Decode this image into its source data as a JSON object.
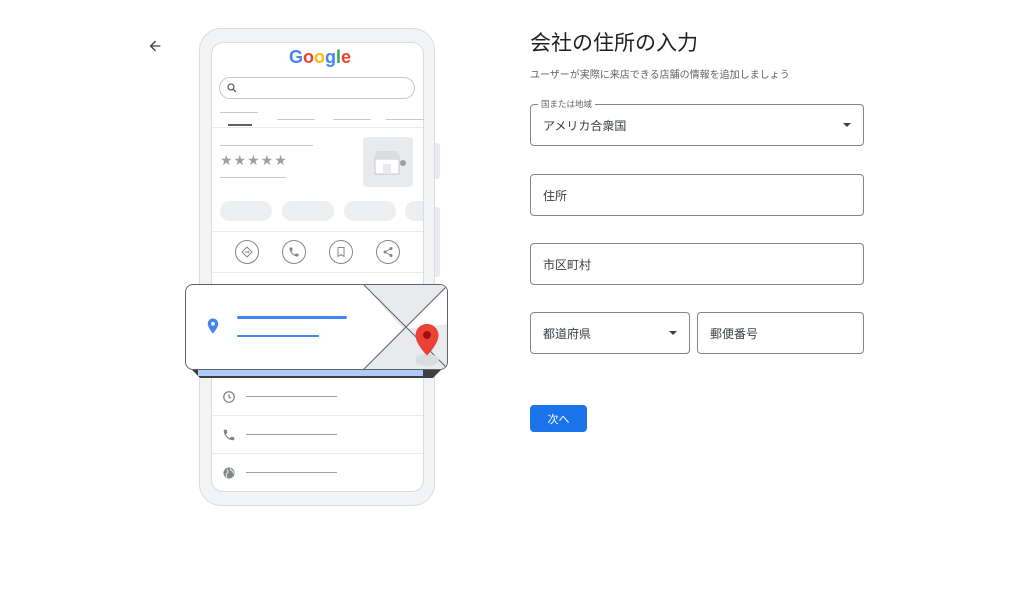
{
  "page": {
    "title": "会社の住所の入力",
    "subtitle": "ユーザーが実際に来店できる店舗の情報を追加しましょう"
  },
  "illustration": {
    "logo_letters": [
      "G",
      "o",
      "o",
      "g",
      "l",
      "e"
    ],
    "logo_colors": [
      "#4285f4",
      "#ea4335",
      "#fbbc05",
      "#4285f4",
      "#34a853",
      "#ea4335"
    ],
    "stars": "★★★★★",
    "accent_blue": "#4285f4",
    "pin_red": "#ea4335"
  },
  "form": {
    "country_label": "国または地域",
    "country_value": "アメリカ合衆国",
    "address_placeholder": "住所",
    "city_placeholder": "市区町村",
    "state_placeholder": "都道府県",
    "zip_placeholder": "郵便番号",
    "next_button": "次へ"
  },
  "colors": {
    "primary": "#1a73e8",
    "border": "#80868b",
    "text_secondary": "#5f6368"
  },
  "icons": {
    "back": "arrow-left-icon",
    "dropdown": "caret-down-icon"
  }
}
